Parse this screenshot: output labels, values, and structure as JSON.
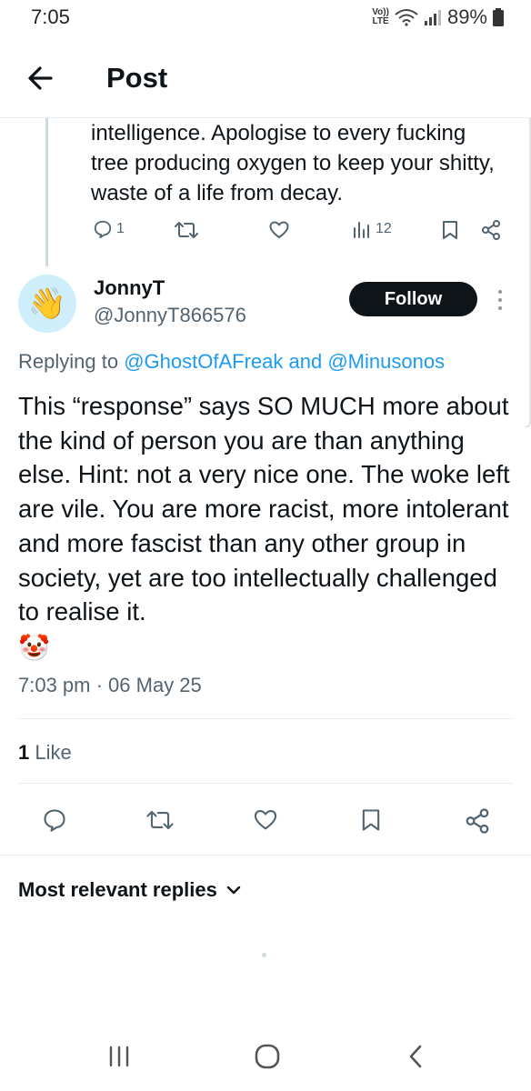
{
  "status_bar": {
    "time": "7:05",
    "network": "Vo)) LTE",
    "battery": "89%"
  },
  "header": {
    "title": "Post"
  },
  "previous_post": {
    "text": "intelligence. Apologise to every fucking tree producing oxygen to keep your shitty, waste of a life from decay.",
    "reply_count": "1",
    "views": "12"
  },
  "post": {
    "display_name": "JonnyT",
    "handle": "@JonnyT866576",
    "avatar_emoji": "👋",
    "follow_label": "Follow",
    "replying_prefix": "Replying to",
    "mention_1": "@GhostOfAFreak",
    "replying_and": "and",
    "mention_2": "@Minusonos",
    "body": "This “response” says SO MUCH more about the kind of person you are than anything else. Hint: not a very nice one. The woke left are vile. You are more racist, more intolerant and more fascist than any other group in society, yet are too intellectually challenged to realise it.",
    "emoji": "🤡",
    "timestamp": "7:03 pm · 06 May 25",
    "like_count": "1",
    "like_label": "Like"
  },
  "replies": {
    "sort_label": "Most relevant replies"
  },
  "icons": {
    "back": "arrow-left-icon",
    "reply": "speech-bubble-icon",
    "retweet": "retweet-icon",
    "like": "heart-icon",
    "views": "bar-chart-icon",
    "bookmark": "bookmark-icon",
    "share": "share-icon"
  },
  "colors": {
    "accent": "#1d9bf0",
    "text": "#0f1419",
    "muted": "#536471",
    "follow_bg": "#0f1419"
  }
}
